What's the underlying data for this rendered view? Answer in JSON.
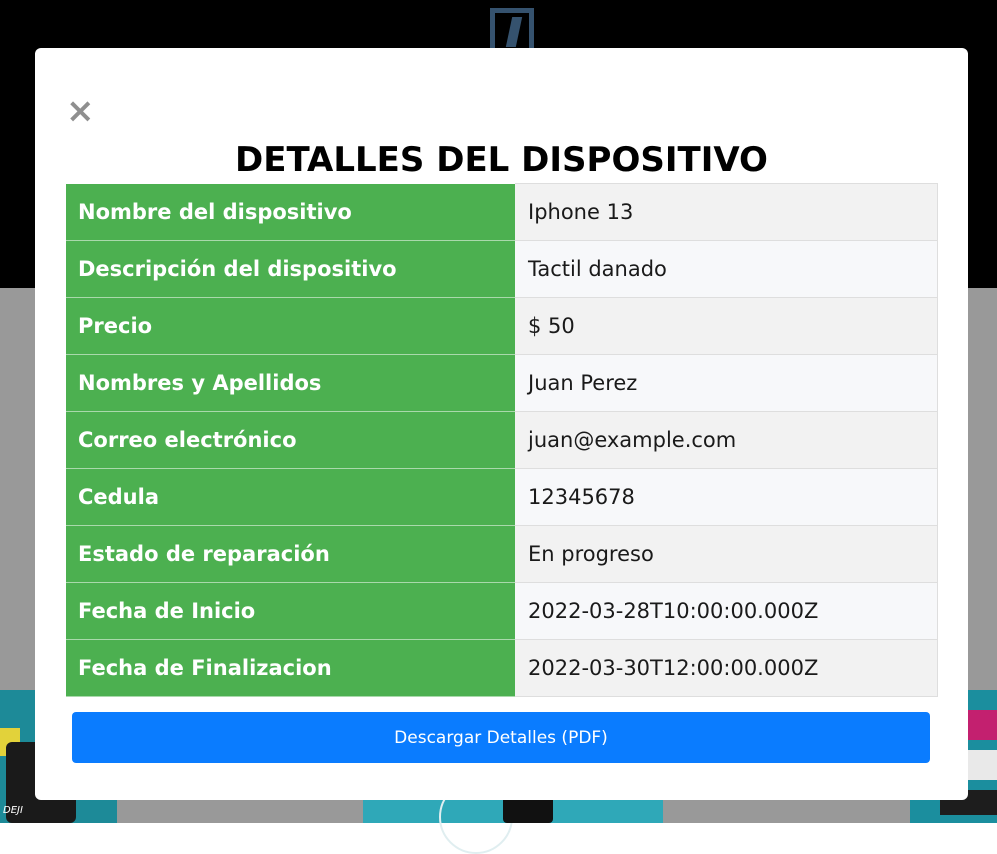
{
  "modal": {
    "close_symbol": "×",
    "title": "DETALLES DEL DISPOSITIVO",
    "download_label": "Descargar Detalles (PDF)",
    "rows": [
      {
        "label": "Nombre del dispositivo",
        "value": "Iphone 13"
      },
      {
        "label": "Descripción del dispositivo",
        "value": "Tactil danado"
      },
      {
        "label": "Precio",
        "value": "$ 50"
      },
      {
        "label": "Nombres y Apellidos",
        "value": "Juan Perez"
      },
      {
        "label": "Correo electrónico",
        "value": "juan@example.com"
      },
      {
        "label": "Cedula",
        "value": "12345678"
      },
      {
        "label": "Estado de reparación",
        "value": "En progreso"
      },
      {
        "label": "Fecha de Inicio",
        "value": "2022-03-28T10:00:00.000Z"
      },
      {
        "label": "Fecha de Finalizacion",
        "value": "2022-03-30T12:00:00.000Z"
      }
    ]
  },
  "background": {
    "card_brand": "DEJI"
  },
  "colors": {
    "label_cell": "#4cb050",
    "button": "#0a7cff",
    "overlay_top": "#000000",
    "overlay_bottom": "#999999"
  }
}
